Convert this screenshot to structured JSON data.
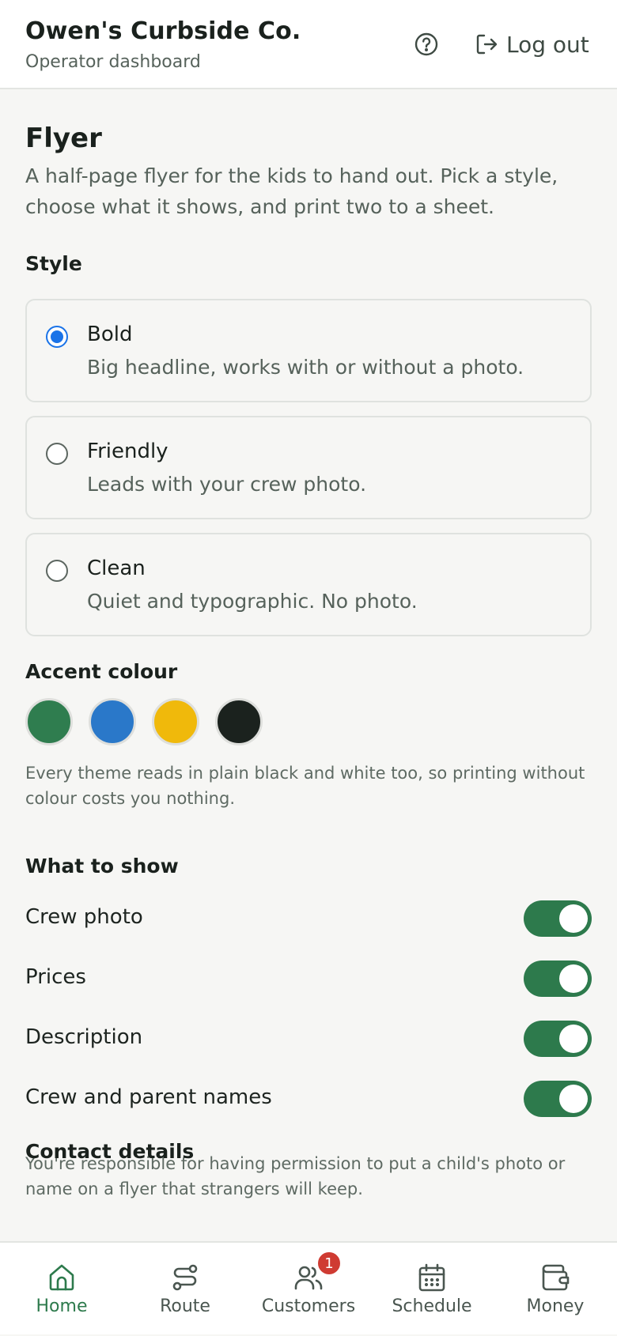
{
  "header": {
    "title": "Owen's Curbside Co.",
    "subtitle": "Operator dashboard",
    "help_icon": "help-circle-icon",
    "logout_label": "Log out"
  },
  "page": {
    "title": "Flyer",
    "lead": "A half-page flyer for the kids to hand out. Pick a style, choose what it shows, and print two to a sheet."
  },
  "style": {
    "label": "Style",
    "options": [
      {
        "title": "Bold",
        "desc": "Big headline, works with or without a photo.",
        "selected": true
      },
      {
        "title": "Friendly",
        "desc": "Leads with your crew photo.",
        "selected": false
      },
      {
        "title": "Clean",
        "desc": "Quiet and typographic. No photo.",
        "selected": false
      }
    ]
  },
  "accent": {
    "label": "Accent colour",
    "swatches": [
      "#2f7d4f",
      "#2a78c9",
      "#f0b90b",
      "#1b221e"
    ],
    "note": "Every theme reads in plain black and white too, so printing without colour costs you nothing."
  },
  "show": {
    "label": "What to show",
    "toggles": [
      {
        "label": "Crew photo",
        "on": true
      },
      {
        "label": "Prices",
        "on": true
      },
      {
        "label": "Description",
        "on": true
      },
      {
        "label": "Crew and parent names",
        "on": true
      }
    ],
    "note": "You're responsible for having permission to put a child's photo or name on a flyer that strangers will keep."
  },
  "next_section_peek": "Contact details",
  "nav": {
    "items": [
      {
        "label": "Home",
        "icon": "home-icon",
        "active": true
      },
      {
        "label": "Route",
        "icon": "route-icon",
        "active": false
      },
      {
        "label": "Customers",
        "icon": "customers-icon",
        "active": false,
        "badge": "1"
      },
      {
        "label": "Schedule",
        "icon": "calendar-icon",
        "active": false
      },
      {
        "label": "Money",
        "icon": "wallet-icon",
        "active": false
      }
    ]
  },
  "colors": {
    "accent_green": "#2d7a4c",
    "radio_blue": "#1a73e8",
    "badge_red": "#cf3b32"
  }
}
